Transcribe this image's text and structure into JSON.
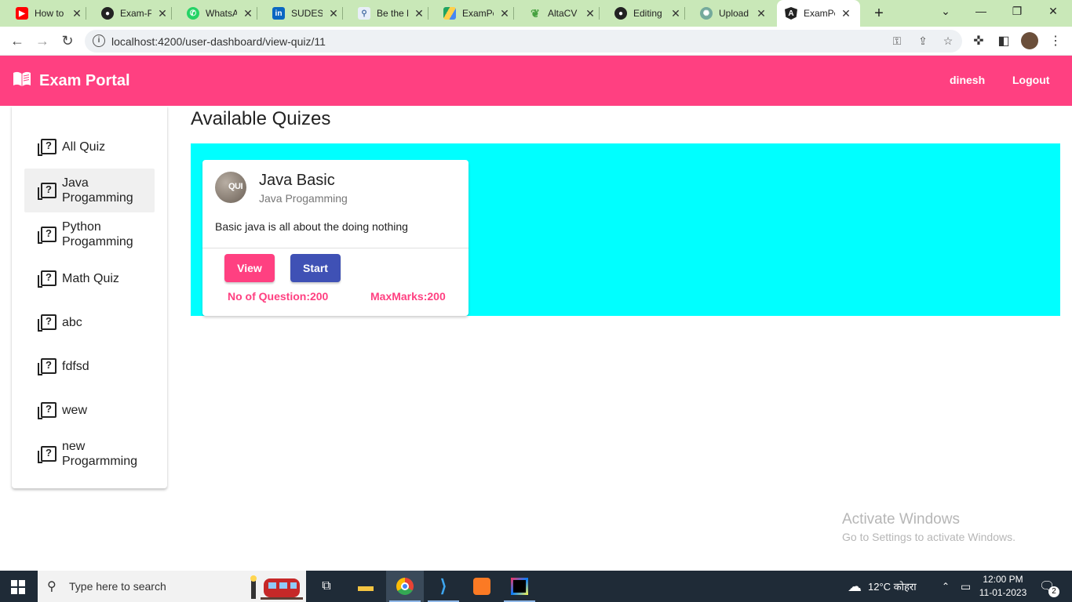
{
  "browser": {
    "tabs": [
      {
        "title": "How to c",
        "favicon": "youtube-icon",
        "color": "#ff0000"
      },
      {
        "title": "Exam-Po",
        "favicon": "github-icon",
        "color": "#222222"
      },
      {
        "title": "WhatsAp",
        "favicon": "whatsapp-icon",
        "color": "#25d366"
      },
      {
        "title": "SUDESH",
        "favicon": "linkedin-icon",
        "color": "#0a66c2"
      },
      {
        "title": "Be the N",
        "favicon": "bethe-icon",
        "color": "#4a6fa5"
      },
      {
        "title": "ExamPor",
        "favicon": "drive-icon",
        "color": "#1fa463"
      },
      {
        "title": "AltaCV |",
        "favicon": "overleaf-icon",
        "color": "#47a141"
      },
      {
        "title": "Editing C",
        "favicon": "github-icon",
        "color": "#222222"
      },
      {
        "title": "Upload |",
        "favicon": "chatgpt-icon",
        "color": "#74aa9c"
      },
      {
        "title": "ExamPo",
        "favicon": "angular-icon",
        "color": "#222222"
      }
    ],
    "url": "localhost:4200/user-dashboard/view-quiz/11"
  },
  "header": {
    "brand": "Exam Portal",
    "user": "dinesh",
    "logout": "Logout",
    "color": "#ff4081"
  },
  "sidebar": {
    "items": [
      {
        "label": "All Quiz"
      },
      {
        "label": "Java Progamming"
      },
      {
        "label": "Python Progamming"
      },
      {
        "label": "Math Quiz"
      },
      {
        "label": "abc"
      },
      {
        "label": "fdfsd"
      },
      {
        "label": "wew"
      },
      {
        "label": "new Progarmming"
      }
    ],
    "selected_index": 1
  },
  "main": {
    "title": "Available Quizes",
    "background": "#00ffff",
    "quizzes": [
      {
        "avatar_text": "QUI",
        "title": "Java Basic",
        "category": "Java Progamming",
        "description": "Basic java is all about the doing nothing",
        "view_label": "View",
        "start_label": "Start",
        "questions": "No of Question:200",
        "max_marks": "MaxMarks:200"
      }
    ]
  },
  "watermark": {
    "line1": "Activate Windows",
    "line2": "Go to Settings to activate Windows."
  },
  "taskbar": {
    "search_placeholder": "Type here to search",
    "weather": "12°C कोहरा",
    "time": "12:00 PM",
    "date": "11-01-2023",
    "notifications": "2"
  }
}
